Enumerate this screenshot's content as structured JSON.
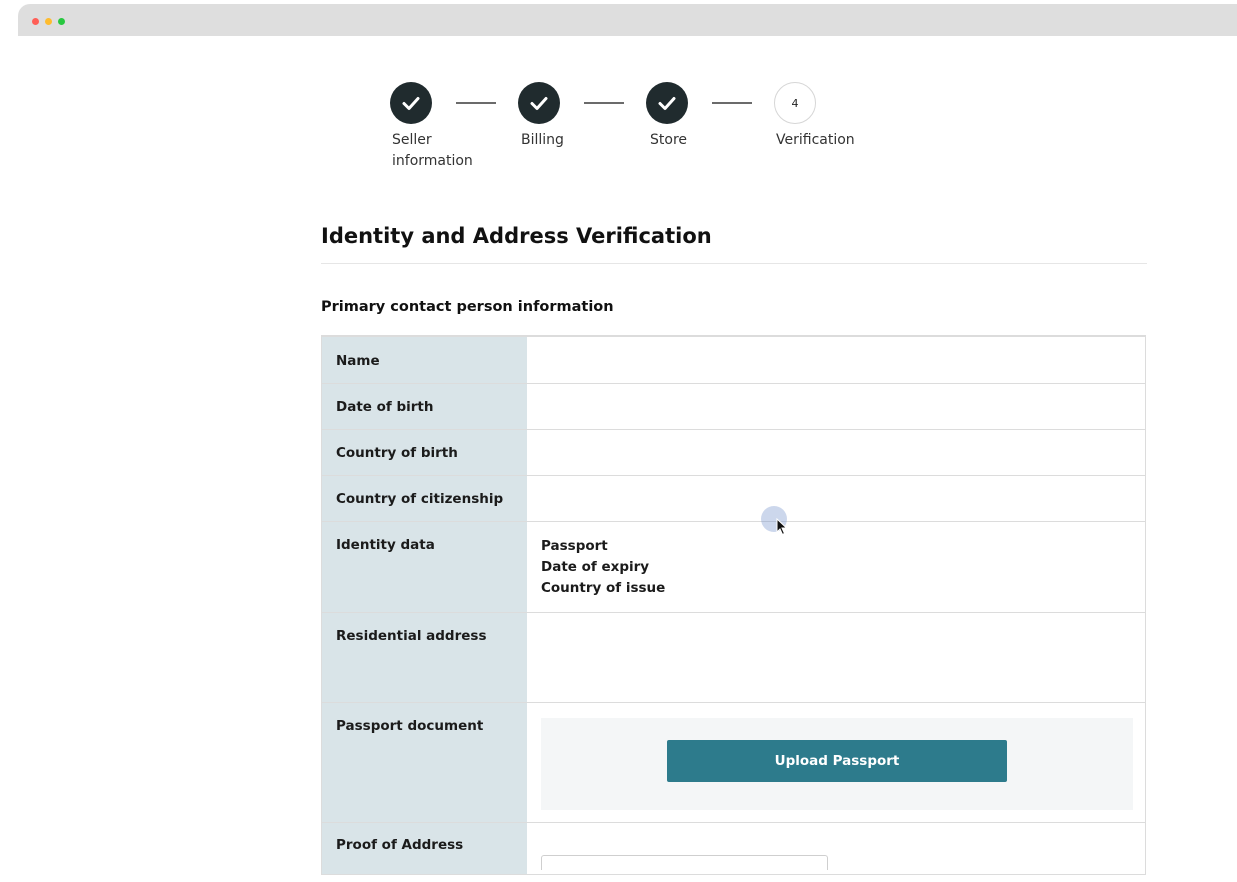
{
  "window": {
    "controls": {
      "close_color": "#ff5f57",
      "minimize_color": "#febc2e",
      "maximize_color": "#28c840"
    }
  },
  "stepper": {
    "steps": [
      {
        "label_line1": "Seller",
        "label_line2": "information",
        "status": "complete",
        "icon": "check-icon"
      },
      {
        "label_line1": "Billing",
        "status": "complete",
        "icon": "check-icon"
      },
      {
        "label_line1": "Store",
        "status": "complete",
        "icon": "check-icon"
      },
      {
        "number": "4",
        "label_line1": "Verification",
        "status": "current"
      }
    ]
  },
  "page": {
    "title": "Identity and Address Verification",
    "section_title": "Primary contact person information"
  },
  "table": {
    "rows": [
      {
        "label": "Name"
      },
      {
        "label": "Date of birth"
      },
      {
        "label": "Country of birth"
      },
      {
        "label": "Country of citizenship"
      },
      {
        "label": "Identity data",
        "values": [
          "Passport",
          "Date of expiry",
          "Country of issue"
        ]
      },
      {
        "label": "Residential address"
      },
      {
        "label": "Passport document",
        "button": "Upload Passport"
      },
      {
        "label": "Proof of Address"
      }
    ]
  },
  "colors": {
    "step_complete": "#202b2e",
    "label_column_bg": "#d9e4e8",
    "primary_button": "#2d7b8c"
  }
}
